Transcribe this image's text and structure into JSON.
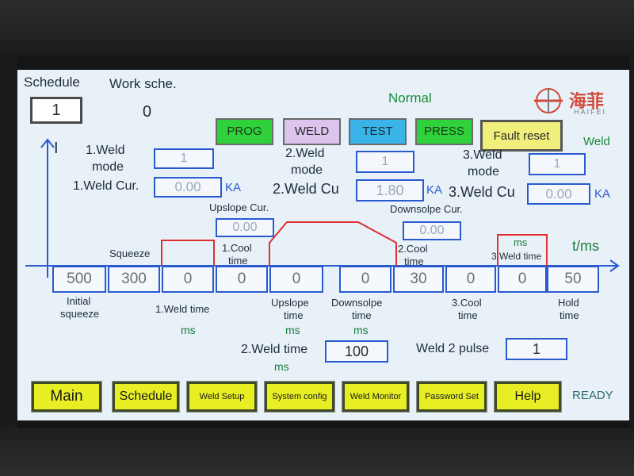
{
  "header": {
    "schedule_label": "Schedule",
    "schedule_value": "1",
    "work_sche_label": "Work sche.",
    "work_sche_value": "0",
    "status": "Normal",
    "brand_cn": "海菲",
    "brand_en": "HAIFEI"
  },
  "modes": {
    "prog": "PROG",
    "weld": "WELD",
    "test": "TEST",
    "press": "PRESS",
    "fault_reset": "Fault reset",
    "weld_indicator": "Weld"
  },
  "axes": {
    "y": "I",
    "x": "t/ms"
  },
  "weld1": {
    "mode_label_1": "1.Weld",
    "mode_label_2": "mode",
    "mode_value": "1",
    "cur_label": "1.Weld Cur.",
    "cur_value": "0.00",
    "cur_unit": "KA"
  },
  "weld2": {
    "mode_label_1": "2.Weld",
    "mode_label_2": "mode",
    "mode_value": "1",
    "cur_label": "2.Weld  Cu",
    "cur_value": "1.80",
    "cur_unit": "KA"
  },
  "weld3": {
    "mode_label_1": "3.Weld",
    "mode_label_2": "mode",
    "mode_value": "1",
    "cur_label": "3.Weld  Cu",
    "cur_value": "0.00",
    "cur_unit": "KA"
  },
  "upslope": {
    "label": "Upslope Cur.",
    "value": "0.00"
  },
  "downslope": {
    "label": "Downsolpe Cur.",
    "value": "0.00"
  },
  "timeline": {
    "squeeze_label": "Squeeze",
    "cool1_label_1": "1.Cool",
    "cool1_label_2": "time",
    "cool2_label_1": "2.Cool",
    "cool2_label_2": "time",
    "weld3_ms": "ms",
    "weld3_time_label": "3.Weld time",
    "values": [
      "500",
      "300",
      "0",
      "0",
      "0",
      "0",
      "30",
      "0",
      "0",
      "50"
    ],
    "initial_squeeze_1": "Initial",
    "initial_squeeze_2": "squeeze",
    "weld1_time": "1.Weld time",
    "weld1_ms": "ms",
    "upslope_1": "Upslope",
    "upslope_2": "time",
    "upslope_ms": "ms",
    "downslope_1": "Downsolpe",
    "downslope_2": "time",
    "downslope_ms": "ms",
    "cool3_1": "3.Cool",
    "cool3_2": "time",
    "hold_1": "Hold",
    "hold_2": "time"
  },
  "weld2_time": {
    "label": "2.Weld time",
    "value": "100",
    "unit": "ms"
  },
  "weld2_pulse": {
    "label": "Weld 2 pulse",
    "value": "1"
  },
  "nav": {
    "main": "Main",
    "schedule": "Schedule",
    "weld_setup": "Weld Setup",
    "system_config": "System config",
    "weld_monitor": "Weld Monitor",
    "password_set": "Password Set",
    "help": "Help",
    "status": "READY"
  },
  "colors": {
    "screen_bg": "#e8f1f8",
    "field_border": "#2a5ad0",
    "prog": "#2fd23a",
    "weld": "#dcc4ee",
    "test": "#3ab4e8",
    "press": "#2fd23a",
    "fault": "#f1ef7c",
    "nav": "#e7ee24",
    "waveform": "#e03030"
  }
}
